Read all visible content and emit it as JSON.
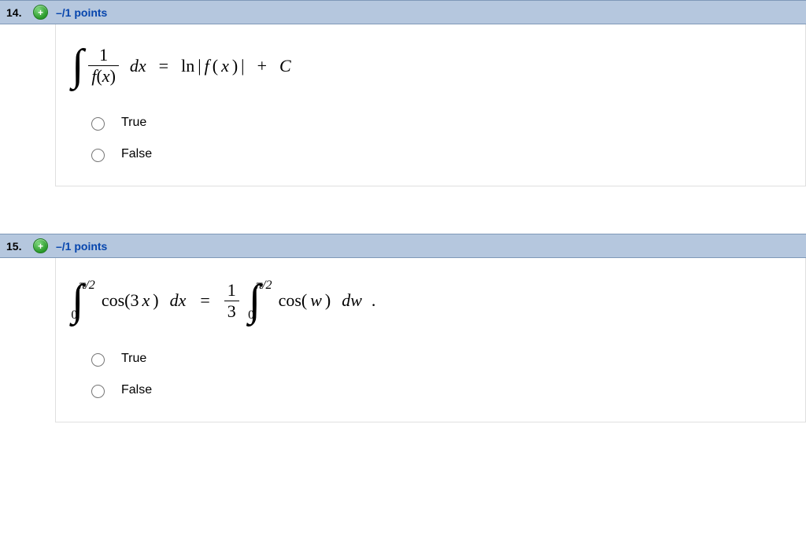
{
  "questions": [
    {
      "number": "14.",
      "points": "–/1 points",
      "options": {
        "true": "True",
        "false": "False"
      },
      "equation": {
        "fnum": "1",
        "fden_f": "f",
        "fden_x": "x",
        "dx": "dx",
        "eq": "=",
        "ln": "ln",
        "bar1": "|",
        "res_f": "f",
        "res_x": "x",
        "bar2": "|",
        "plus": "+",
        "C": "C"
      }
    },
    {
      "number": "15.",
      "points": "–/1 points",
      "options": {
        "true": "True",
        "false": "False"
      },
      "equation": {
        "upper": "π/2",
        "lower": "0",
        "cos1": "cos(3",
        "x": "x",
        "paren1": ")",
        "dx": "dx",
        "eq": "=",
        "fnum": "1",
        "fden": "3",
        "upper2": "π/2",
        "lower2": "0",
        "cos2": "cos(",
        "w": "w",
        "paren2": ")",
        "dw": "dw",
        "dot": "."
      }
    }
  ]
}
